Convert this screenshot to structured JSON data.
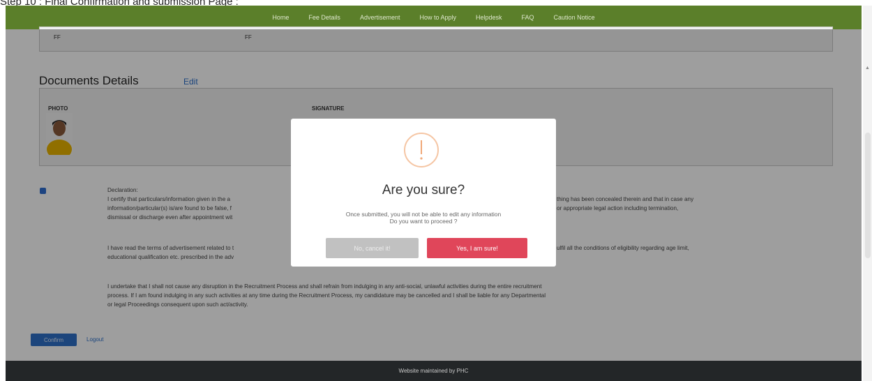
{
  "caption": "Step 10 : Final Confirmation and submission Page :",
  "navbar": {
    "items": [
      "Home",
      "Fee Details",
      "Advertisement",
      "How to Apply",
      "Helpdesk",
      "FAQ",
      "Caution Notice"
    ]
  },
  "top_panel": {
    "left_value": "FF",
    "right_value": "FF"
  },
  "documents": {
    "title": "Documents Details",
    "edit_label": "Edit",
    "photo_label": "PHOTO",
    "signature_label": "SIGNATURE"
  },
  "declaration": {
    "heading": "Declaration:",
    "paragraph1_line1": "I certify that particulars/information given in the a",
    "paragraph1_line1_end": "thing has been concealed therein and that in case any",
    "paragraph1_line2": "information/particular(s) is/are found to be false, f",
    "paragraph1_line2_end": "or appropriate legal action including termination,",
    "paragraph1_line3": "dismissal or discharge even after appointment wit",
    "paragraph2_line1": "I have read the terms of advertisement related to t",
    "paragraph2_line1_end": "ulfil all the conditions of eligibility regarding age limit,",
    "paragraph2_line2": "educational qualification etc. prescribed in the adv",
    "paragraph3_line1": "I undertake that I shall not cause any disruption in the Recruitment Process and shall refrain from indulging in any anti-social, unlawful activities during the entire recruitment",
    "paragraph3_line2": "process. If I am found indulging in any such activities at any time during the Recruitment Process, my candidature may be cancelled and I shall be liable for any Departmental",
    "paragraph3_line3": "or legal Proceedings consequent upon such act/activity."
  },
  "actions": {
    "confirm_label": "Confirm",
    "logout_label": "Logout"
  },
  "footer": {
    "text": "Website maintained by PHC"
  },
  "modal": {
    "icon": "exclamation-icon",
    "title": "Are you sure?",
    "text_line1": "Once submitted, you will not be able to edit any information",
    "text_line2": "Do you want to proceed ?",
    "cancel_label": "No, cancel it!",
    "confirm_label": "Yes, I am sure!"
  },
  "colors": {
    "navbar": "#5b7f2a",
    "accent_blue": "#2e70c8",
    "modal_confirm": "#e0465a",
    "modal_cancel": "#c1c1c1",
    "warning_icon": "#f5c5a3"
  }
}
